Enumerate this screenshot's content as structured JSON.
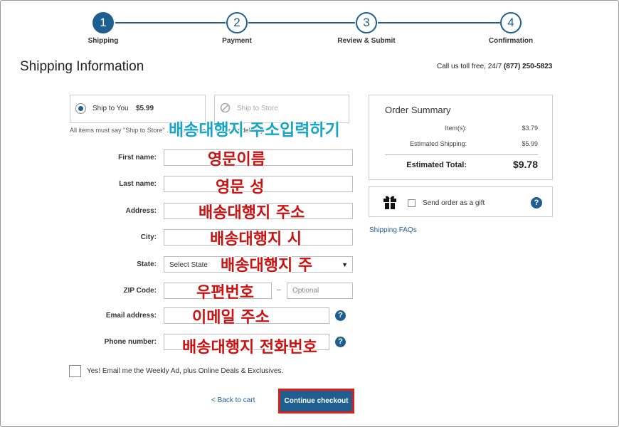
{
  "stepper": [
    {
      "number": "1",
      "label": "Shipping"
    },
    {
      "number": "2",
      "label": "Payment"
    },
    {
      "number": "3",
      "label": "Review & Submit"
    },
    {
      "number": "4",
      "label": "Confirmation"
    }
  ],
  "page_title": "Shipping Information",
  "tollfree": {
    "text": "Call us toll free, 24/7 ",
    "phone": "(877) 250-5823"
  },
  "shipping_options": {
    "ship_to_you": {
      "label": "Ship to You",
      "price": "$5.99"
    },
    "ship_to_store": {
      "label": "Ship to Store"
    }
  },
  "note": "All items must say \"Ship to Store\" … can ship to … order for delivery.",
  "form": {
    "first_name": {
      "label": "First name:"
    },
    "last_name": {
      "label": "Last name:"
    },
    "address": {
      "label": "Address:"
    },
    "city": {
      "label": "City:"
    },
    "state": {
      "label": "State:",
      "value": "Select State"
    },
    "zip": {
      "label": "ZIP Code:",
      "dash": "–",
      "ext_placeholder": "Optional"
    },
    "email": {
      "label": "Email address:"
    },
    "phone": {
      "label": "Phone number:"
    }
  },
  "annotations": {
    "heading": "배송대행지 주소입력하기",
    "first_name": "영문이름",
    "last_name": "영문 성",
    "address": "배송대행지 주소",
    "city": "배송대행지 시",
    "state": "배송대행지 주",
    "zip": "우편번호",
    "email": "이메일 주소",
    "phone": "배송대행지 전화번호"
  },
  "optin": "Yes! Email me the Weekly Ad, plus Online Deals & Exclusives.",
  "back_link": "< Back to cart",
  "continue_label": "Continue checkout",
  "order_summary": {
    "title": "Order Summary",
    "items_label": "Item(s):",
    "items_value": "$3.79",
    "shipping_label": "Estimated Shipping:",
    "shipping_value": "$5.99",
    "total_label": "Estimated Total:",
    "total_value": "$9.78"
  },
  "gift": {
    "label": "Send order as a gift",
    "help": "?"
  },
  "faq": "Shipping FAQs",
  "help_glyph": "?",
  "colors": {
    "accent": "#1f5f8f",
    "annotation_red": "#cc1111",
    "annotation_blue": "#17a6c4",
    "highlight_border": "#e21b1b"
  }
}
